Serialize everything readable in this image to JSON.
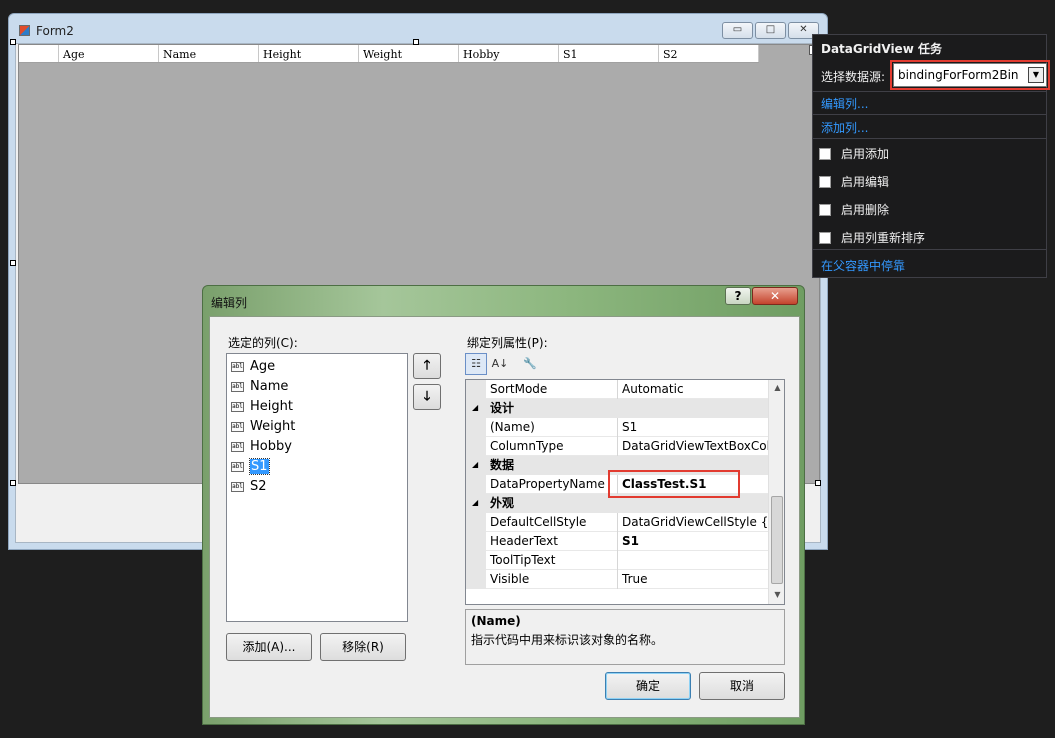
{
  "form2": {
    "title": "Form2",
    "caption_buttons": {
      "minimize": "▭",
      "maximize": "□",
      "close": "✕"
    },
    "grid_columns": [
      "Age",
      "Name",
      "Height",
      "Weight",
      "Hobby",
      "S1",
      "S2"
    ]
  },
  "tasks": {
    "title": "DataGridView 任务",
    "datasource_label": "选择数据源:",
    "datasource_value": "bindingForForm2Bin",
    "edit_columns_link": "编辑列...",
    "add_column_link": "添加列...",
    "checks": [
      {
        "label": "启用添加",
        "checked": false
      },
      {
        "label": "启用编辑",
        "checked": false
      },
      {
        "label": "启用删除",
        "checked": false
      },
      {
        "label": "启用列重新排序",
        "checked": false
      }
    ],
    "dock_link": "在父容器中停靠"
  },
  "dialog": {
    "title": "编辑列",
    "help": "?",
    "close": "✕",
    "selected_columns_label": "选定的列(C):",
    "columns": [
      "Age",
      "Name",
      "Height",
      "Weight",
      "Hobby",
      "S1",
      "S2"
    ],
    "selected_index": 5,
    "move_up": "🡑",
    "move_down": "🡓",
    "add_button": "添加(A)...",
    "remove_button": "移除(R)",
    "props_label": "绑定列属性(P):",
    "tools": {
      "categorized": "☷",
      "alphabetical": "A↓",
      "property_pages": "🔧"
    },
    "props": {
      "sortmode": {
        "name": "SortMode",
        "value": "Automatic"
      },
      "cat_design": "设计",
      "name": {
        "name": "(Name)",
        "value": "S1"
      },
      "columntype": {
        "name": "ColumnType",
        "value": "DataGridViewTextBoxColu"
      },
      "cat_data": "数据",
      "datapropertyname": {
        "name": "DataPropertyName",
        "value": "ClassTest.S1"
      },
      "cat_appearance": "外观",
      "defaultcellstyle": {
        "name": "DefaultCellStyle",
        "value": "DataGridViewCellStyle { }"
      },
      "headertext": {
        "name": "HeaderText",
        "value": "S1"
      },
      "tooltiptext": {
        "name": "ToolTipText",
        "value": ""
      },
      "visible": {
        "name": "Visible",
        "value": "True"
      }
    },
    "desc_title": "(Name)",
    "desc_text": "指示代码中用来标识该对象的名称。",
    "ok": "确定",
    "cancel": "取消"
  },
  "colors": {
    "highlight": "#e23b30",
    "link": "#3399ff",
    "selection": "#3399ff"
  }
}
